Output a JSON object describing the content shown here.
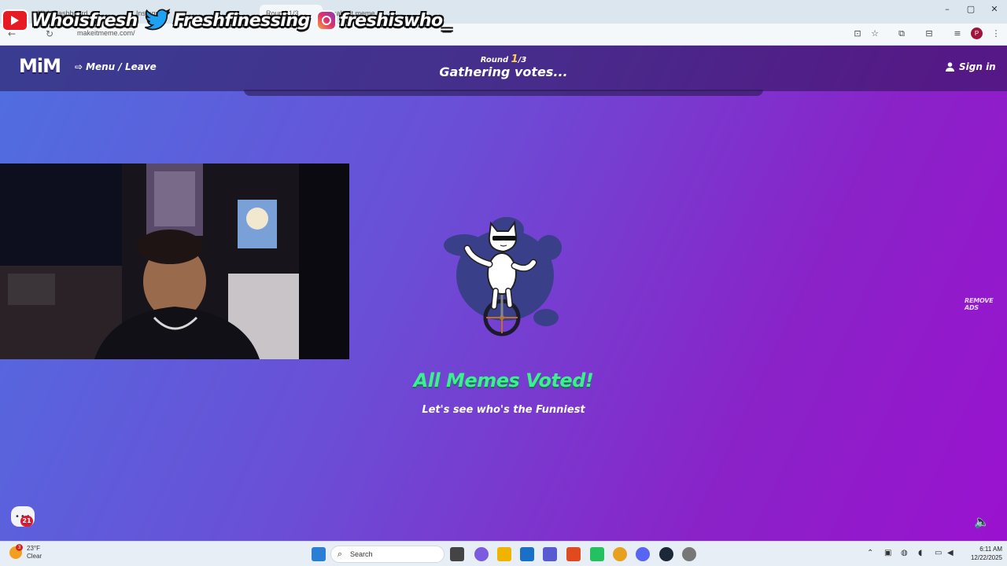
{
  "browser": {
    "tabs": [
      "Kick Dashboard",
      "Instagram",
      "make it meme",
      "Round 1/3"
    ],
    "url": "makeitmeme.com/",
    "profile_initial": "P"
  },
  "overlay": {
    "youtube_handle": "Whoisfresh",
    "twitter_handle": "Freshfinessing",
    "instagram_handle": "freshiswho_"
  },
  "game": {
    "logo": "MiM",
    "menu_leave": "Menu / Leave",
    "round_label": "Round",
    "round_current": "1",
    "round_total": "/3",
    "status": "Gathering votes...",
    "sign_in": "Sign in",
    "remove_ads": "REMOVE ADS",
    "voted_title": "All Memes Voted!",
    "voted_subtitle": "Let's see who's the Funniest",
    "chat_badge": "21"
  },
  "taskbar": {
    "weather_temp": "23°F",
    "weather_cond": "Clear",
    "weather_alert": "3",
    "search_label": "Search",
    "time": "6:11 AM",
    "date": "12/22/2025"
  },
  "colors": {
    "accent_green": "#3cf08f",
    "round_yellow": "#ffd24a",
    "bg_start": "#4f6fe0",
    "bg_end": "#9a12cf"
  }
}
